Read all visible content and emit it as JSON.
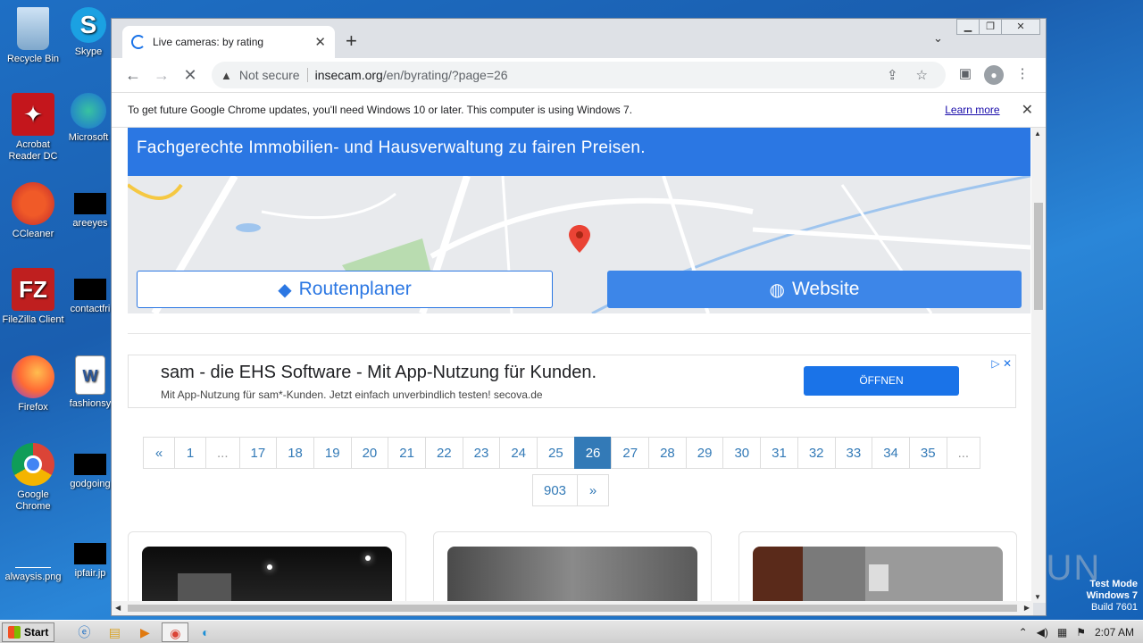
{
  "desktop": {
    "icons": [
      {
        "label": "Recycle Bin",
        "icon": "recycle-bin-icon"
      },
      {
        "label": "Skype",
        "icon": "skype-icon"
      },
      {
        "label": "Acrobat Reader DC",
        "icon": "acrobat-icon"
      },
      {
        "label": "Microsoft",
        "icon": "edge-icon"
      },
      {
        "label": "CCleaner",
        "icon": "ccleaner-icon"
      },
      {
        "label": "areeyes",
        "icon": "file-icon"
      },
      {
        "label": "FileZilla Client",
        "icon": "filezilla-icon"
      },
      {
        "label": "contactfri",
        "icon": "file-icon"
      },
      {
        "label": "Firefox",
        "icon": "firefox-icon"
      },
      {
        "label": "fashionsy",
        "icon": "word-icon"
      },
      {
        "label": "Google Chrome",
        "icon": "chrome-icon"
      },
      {
        "label": "godgoing",
        "icon": "file-icon"
      },
      {
        "label": "alwaysis.png",
        "icon": "image-icon"
      },
      {
        "label": "ipfair.jp",
        "icon": "file-icon"
      }
    ]
  },
  "browser": {
    "tab_title": "Live cameras: by rating",
    "new_tab_label": "+",
    "address": {
      "security_label": "Not secure",
      "host": "insecam.org",
      "path": "/en/byrating/?page=26"
    },
    "infobar": {
      "message": "To get future Google Chrome updates, you'll need Windows 10 or later. This computer is using Windows 7.",
      "link": "Learn more"
    }
  },
  "page": {
    "map_ad": {
      "banner_text": "Fachgerechte Immobilien- und Hausverwaltung zu fairen Preisen.",
      "route_button": "Routenplaner",
      "website_button": "Website"
    },
    "text_ad": {
      "headline": "sam - die EHS Software - Mit App-Nutzung für Kunden.",
      "subline": "Mit App-Nutzung für sam*-Kunden. Jetzt einfach unverbindlich testen! secova.de",
      "cta": "ÖFFNEN"
    },
    "pagination": {
      "prev": "«",
      "next": "»",
      "ellipsis": "...",
      "pages_row1": [
        "1",
        "...",
        "17",
        "18",
        "19",
        "20",
        "21",
        "22",
        "23",
        "24",
        "25",
        "26",
        "27",
        "28",
        "29",
        "30",
        "31",
        "32",
        "33",
        "34",
        "35",
        "..."
      ],
      "last_page": "903",
      "current": "26"
    }
  },
  "taskbar": {
    "start_label": "Start",
    "clock": "2:07 AM"
  },
  "watermark": {
    "line1": "Test Mode",
    "line2": "Windows 7",
    "line3": "Build 7601",
    "brand": "ANY RUN"
  }
}
